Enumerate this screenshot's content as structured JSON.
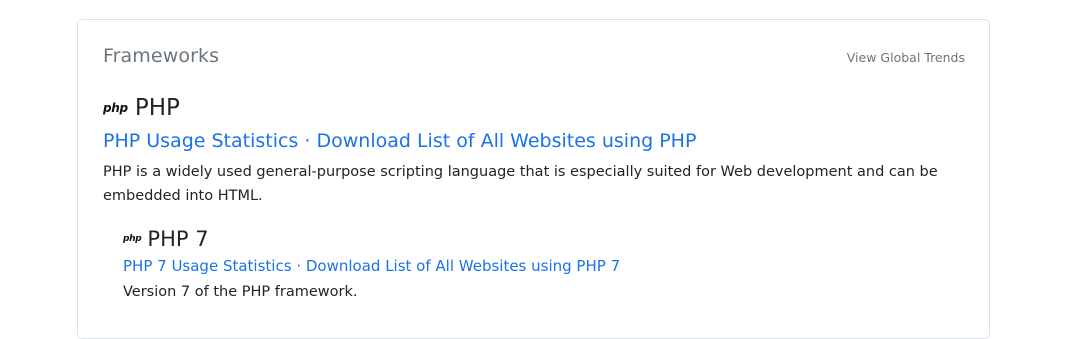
{
  "card": {
    "title": "Frameworks",
    "global_trends_label": "View Global Trends"
  },
  "main_tech": {
    "icon_text": "php",
    "icon": "php-logo-icon",
    "name": "PHP",
    "usage_link": "PHP Usage Statistics",
    "separator": "·",
    "download_link": "Download List of All Websites using PHP",
    "description": "PHP is a widely used general-purpose scripting language that is especially suited for Web development and can be embedded into HTML."
  },
  "sub_tech": {
    "icon_text": "php",
    "icon": "php-logo-icon",
    "name": "PHP 7",
    "usage_link": "PHP 7 Usage Statistics",
    "separator": "·",
    "download_link": "Download List of All Websites using PHP 7",
    "description": "Version 7 of the PHP framework."
  },
  "colors": {
    "link": "#1a73e8",
    "muted": "#6c757d",
    "text": "#212529",
    "border": "#dee2e6"
  }
}
